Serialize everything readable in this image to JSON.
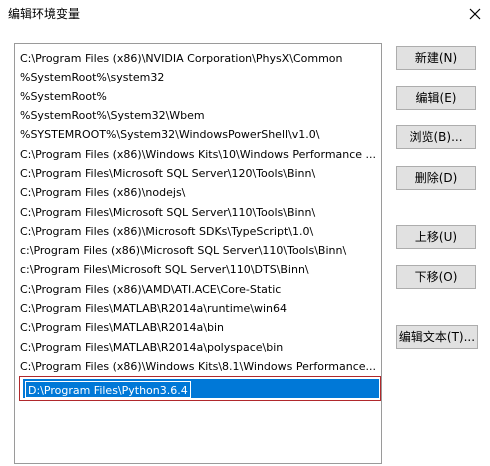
{
  "window": {
    "title": "编辑环境变量",
    "close_icon": "close-icon"
  },
  "list": {
    "items": [
      "C:\\Program Files (x86)\\NVIDIA Corporation\\PhysX\\Common",
      "%SystemRoot%\\system32",
      "%SystemRoot%",
      "%SystemRoot%\\System32\\Wbem",
      "%SYSTEMROOT%\\System32\\WindowsPowerShell\\v1.0\\",
      "C:\\Program Files (x86)\\Windows Kits\\10\\Windows Performance ...",
      "C:\\Program Files\\Microsoft SQL Server\\120\\Tools\\Binn\\",
      "C:\\Program Files (x86)\\nodejs\\",
      "C:\\Program Files\\Microsoft SQL Server\\110\\Tools\\Binn\\",
      "C:\\Program Files (x86)\\Microsoft SDKs\\TypeScript\\1.0\\",
      "c:\\Program Files (x86)\\Microsoft SQL Server\\110\\Tools\\Binn\\",
      "c:\\Program Files\\Microsoft SQL Server\\110\\DTS\\Binn\\",
      "C:\\Program Files (x86)\\AMD\\ATI.ACE\\Core-Static",
      "C:\\Program Files\\MATLAB\\R2014a\\runtime\\win64",
      "C:\\Program Files\\MATLAB\\R2014a\\bin",
      "C:\\Program Files\\MATLAB\\R2014a\\polyspace\\bin",
      "C:\\Program Files (x86)\\Windows Kits\\8.1\\Windows Performance..."
    ],
    "editing_value": "D:\\Program Files\\Python3.6.4"
  },
  "buttons": {
    "new": "新建(N)",
    "edit": "编辑(E)",
    "browse": "浏览(B)...",
    "delete": "删除(D)",
    "move_up": "上移(U)",
    "move_down": "下移(O)",
    "edit_text": "编辑文本(T)..."
  },
  "colors": {
    "selection": "#0078d7",
    "highlight_box": "#b0282c"
  }
}
